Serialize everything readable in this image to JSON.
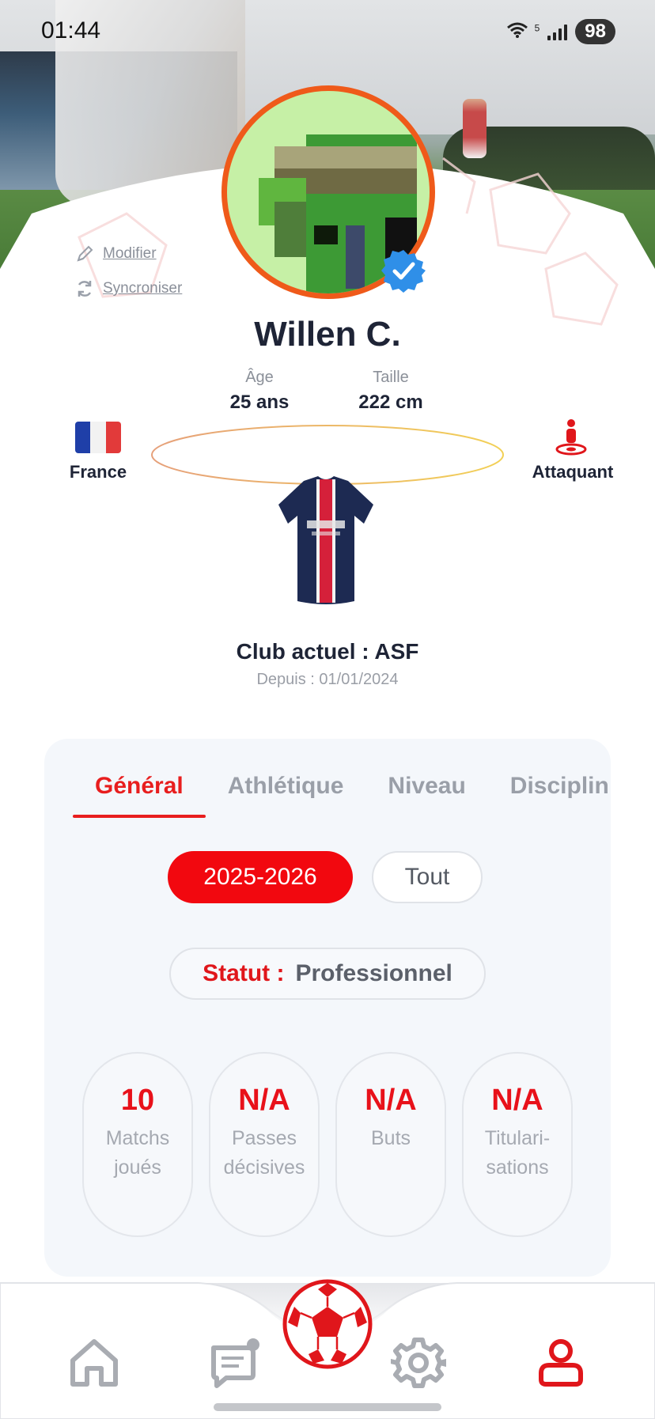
{
  "status_bar": {
    "time": "01:44",
    "wifi_label": "5",
    "battery": "98"
  },
  "profile": {
    "name": "Willen C.",
    "verified": true,
    "actions": {
      "edit_label": "Modifier",
      "sync_label": "Syncroniser"
    },
    "age_label": "Âge",
    "age_value": "25 ans",
    "height_label": "Taille",
    "height_value": "222 cm",
    "country": "France",
    "position": "Attaquant",
    "club": "Club actuel : ASF",
    "since": "Depuis : 01/01/2024"
  },
  "tabs": [
    {
      "label": "Général",
      "active": true
    },
    {
      "label": "Athlétique",
      "active": false
    },
    {
      "label": "Niveau",
      "active": false
    },
    {
      "label": "Disciplin",
      "active": false
    }
  ],
  "seasons": [
    {
      "label": "2025-2026",
      "active": true
    },
    {
      "label": "Tout",
      "active": false
    }
  ],
  "statut": {
    "label": "Statut :",
    "value": "Professionnel"
  },
  "stats": [
    {
      "value": "10",
      "label": "Matchs joués"
    },
    {
      "value": "N/A",
      "label": "Passes décisives"
    },
    {
      "value": "N/A",
      "label": "Buts"
    },
    {
      "value": "N/A",
      "label": "Titulari-sations"
    }
  ],
  "bottom_nav": [
    {
      "name": "home-icon",
      "active": false
    },
    {
      "name": "messages-icon",
      "active": false,
      "badge": true
    },
    {
      "name": "soccer-ball-icon",
      "active": false
    },
    {
      "name": "settings-icon",
      "active": false
    },
    {
      "name": "profile-icon",
      "active": true
    }
  ],
  "colors": {
    "accent": "#E81E1E",
    "avatar_ring": "#EF5A1A",
    "verified": "#2F8FE8",
    "flag_blue": "#1F3FA8",
    "flag_white": "#F2F2F2",
    "flag_red": "#E23A3A"
  }
}
